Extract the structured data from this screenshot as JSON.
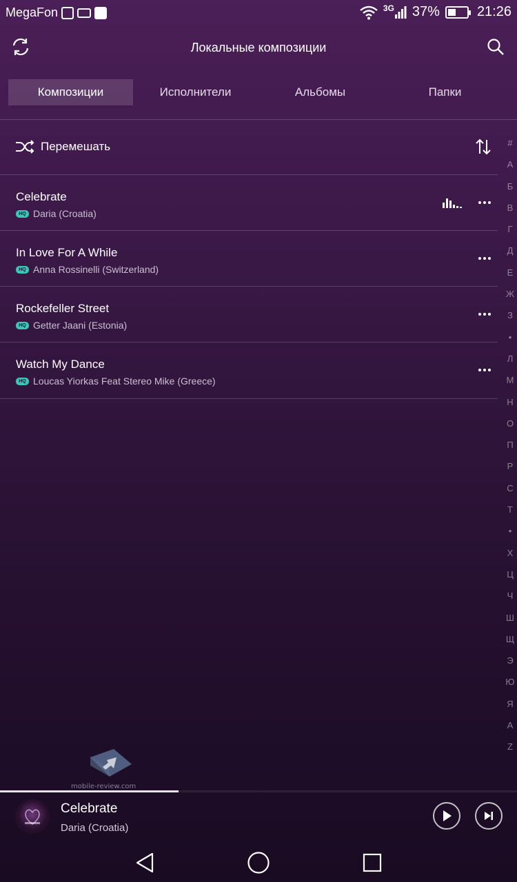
{
  "status_bar": {
    "carrier": "MegaFon",
    "network": "3G",
    "battery": "37%",
    "time": "21:26"
  },
  "app_bar": {
    "title": "Локальные композиции"
  },
  "tabs": [
    {
      "label": "Композиции",
      "active": true
    },
    {
      "label": "Исполнители",
      "active": false
    },
    {
      "label": "Альбомы",
      "active": false
    },
    {
      "label": "Папки",
      "active": false
    }
  ],
  "shuffle": {
    "label": "Перемешать"
  },
  "songs": [
    {
      "title": "Celebrate",
      "artist": "Daria (Croatia)",
      "playing": true
    },
    {
      "title": "In Love For A While",
      "artist": "Anna Rossinelli (Switzerland)",
      "playing": false
    },
    {
      "title": "Rockefeller Street",
      "artist": "Getter Jaani (Estonia)",
      "playing": false
    },
    {
      "title": "Watch My Dance",
      "artist": "Loucas Yiorkas Feat Stereo Mike (Greece)",
      "playing": false
    }
  ],
  "hq_badge": "HQ",
  "alphabet_index": [
    "#",
    "A",
    "Б",
    "В",
    "Г",
    "Д",
    "Е",
    "Ж",
    "З",
    "•",
    "Л",
    "М",
    "Н",
    "О",
    "П",
    "Р",
    "С",
    "Т",
    "•",
    "Х",
    "Ц",
    "Ч",
    "Ш",
    "Щ",
    "Э",
    "Ю",
    "Я",
    "A",
    "Z"
  ],
  "watermark": "mobile-review.com",
  "now_playing": {
    "title": "Celebrate",
    "artist": "Daria (Croatia)",
    "progress": 0.345
  },
  "colors": {
    "accent_hq": "#3cc6b6",
    "background_top": "#4b1f57",
    "background_bottom": "#190b22"
  },
  "icons": {
    "refresh": "refresh-icon",
    "search": "search-icon",
    "shuffle": "shuffle-icon",
    "sort": "sort-icon",
    "more": "more-icon",
    "equalizer": "equalizer-icon",
    "play": "play-icon",
    "next": "next-icon",
    "back": "back-icon",
    "home": "home-icon",
    "recents": "recents-icon"
  }
}
